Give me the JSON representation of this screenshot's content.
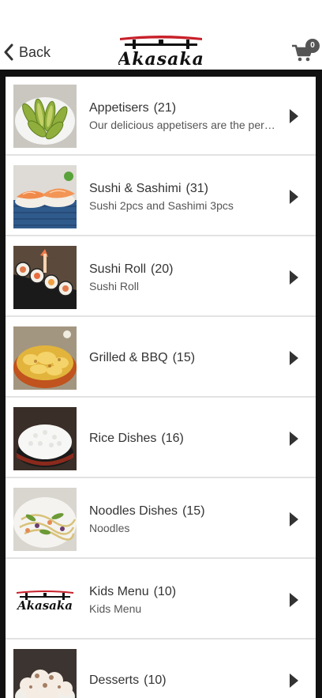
{
  "header": {
    "back_label": "Back",
    "logo_text": "Akasaka",
    "cart_count": "0"
  },
  "categories": [
    {
      "title": "Appetisers",
      "count": "(21)",
      "subtitle": "Our delicious appetisers are the per…",
      "image": "avocado-salad-image"
    },
    {
      "title": "Sushi & Sashimi",
      "count": "(31)",
      "subtitle": "Sushi 2pcs and Sashimi 3pcs",
      "image": "salmon-sushi-image"
    },
    {
      "title": "Sushi Roll",
      "count": "(20)",
      "subtitle": "Sushi Roll",
      "image": "sushi-roll-image"
    },
    {
      "title": "Grilled & BBQ",
      "count": "(15)",
      "subtitle": "",
      "image": "grilled-dish-image"
    },
    {
      "title": "Rice Dishes",
      "count": "(16)",
      "subtitle": "",
      "image": "rice-bowl-image"
    },
    {
      "title": "Noodles Dishes",
      "count": "(15)",
      "subtitle": "Noodles",
      "image": "noodles-image"
    },
    {
      "title": "Kids Menu",
      "count": "(10)",
      "subtitle": "Kids Menu",
      "image": "akasaka-logo-image"
    },
    {
      "title": "Desserts",
      "count": "(10)",
      "subtitle": "",
      "image": "dessert-image"
    }
  ],
  "colors": {
    "text": "#333333",
    "subtext": "#555555",
    "frame": "#111111",
    "logo_red": "#c8202a"
  }
}
